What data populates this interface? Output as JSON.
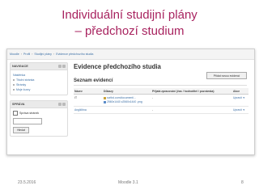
{
  "slide": {
    "title_line1": "Individuální studijní plány",
    "title_line2": "– předchozí studium"
  },
  "app": {
    "breadcrumbs": [
      "Moodle",
      "Profil",
      "Studijní plány",
      "Evidence předchozího studia"
    ],
    "nav_block": {
      "heading": "NAVIGACE",
      "items": [
        "Nástěnka",
        "Titulní stránka",
        "Stránky",
        "Moje kurzy"
      ]
    },
    "search_block": {
      "heading": "SPRÁVA",
      "checkbox_label": "Správa stránek",
      "button": "Hledat"
    },
    "page_title": "Evidence předchozího studia",
    "new_button": "Přidat novou evidenci",
    "section_title": "Seznam evidencí",
    "table": {
      "headers": [
        "Název",
        "Důkazy",
        "Přijatá zpracování (čas / hodnotitel / poznámka)",
        "",
        "Akce"
      ],
      "rows": [
        {
          "name": "IT",
          "files": [
            "scribd.com/document/...",
            "2560x1440 z2560x1440 .png"
          ],
          "comment": "-",
          "action": "Upravit"
        },
        {
          "name": "Angličtina",
          "files": [],
          "comment": "-",
          "action": "Upravit"
        }
      ]
    }
  },
  "footer": {
    "date": "23.5.2016",
    "center": "Moodle 3.1",
    "page_number": "8"
  }
}
